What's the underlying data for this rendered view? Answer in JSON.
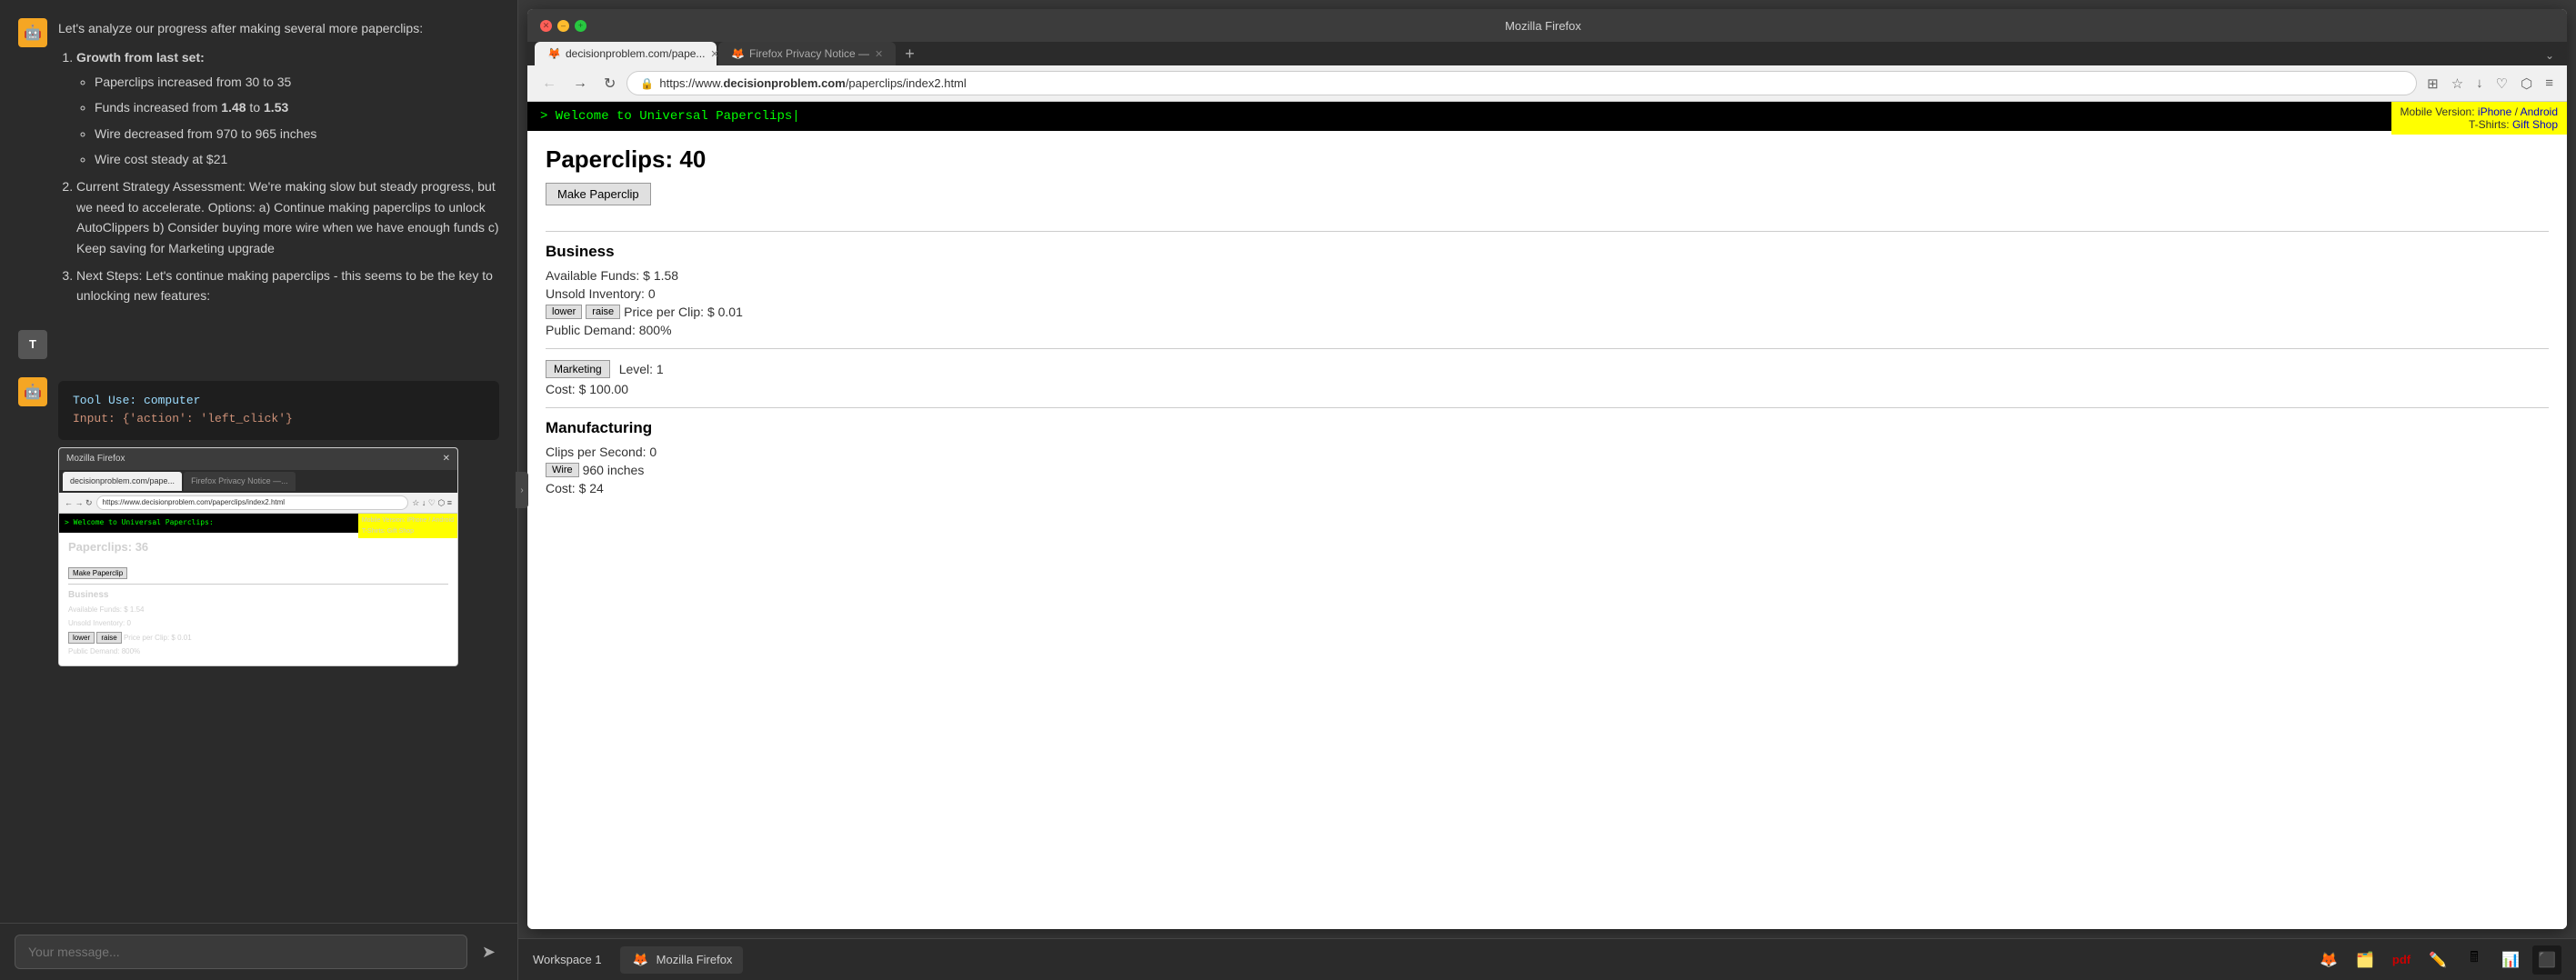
{
  "app": {
    "title": "Mozilla Firefox"
  },
  "left_panel": {
    "messages": [
      {
        "role": "ai",
        "avatar_emoji": "🤖",
        "content_html": "Let's analyze our progress after making several more paperclips:",
        "list_items": [
          {
            "label": "Growth from last set:",
            "sub_items": [
              "Paperclips increased from 30 to 35",
              "Funds increased from 1.48 to 1.53",
              "Wire decreased from 970 to 965 inches",
              "Wire cost steady at $21"
            ]
          },
          {
            "label": "Current Strategy Assessment: We're making slow but steady progress, but we need to accelerate. Options: a) Continue making paperclips to unlock AutoClippers b) Consider buying more wire when we have enough funds c) Keep saving for Marketing upgrade"
          },
          {
            "label": "Next Steps: Let's continue making paperclips - this seems to be the key to unlocking new features:"
          }
        ]
      },
      {
        "role": "user",
        "avatar_label": "T"
      },
      {
        "role": "ai_tool",
        "avatar_emoji": "🤖",
        "tool_text": "Tool Use:  computer",
        "input_text": "Input: {'action': 'left_click'}",
        "has_screenshot": true
      }
    ],
    "input_placeholder": "Your message...",
    "send_button_label": "➤"
  },
  "thumbnail": {
    "title": "Mozilla Firefox",
    "close_btn": "✕",
    "tabs": [
      {
        "label": "decisionproblem.com/pape...",
        "active": true
      },
      {
        "label": "Firefox Privacy Notice —...",
        "active": false
      }
    ],
    "url": "https://www.decisionproblem.com/paperclips/index2.html",
    "terminal_text": "> Welcome to Universal Paperclips:",
    "paperclips": "Paperclips: 36",
    "make_btn": "Make Paperclip",
    "business_title": "Business",
    "funds": "Available Funds: $ 1.54",
    "inventory": "Unsold Inventory: 0",
    "price_label": "Price per Clip: $ 0.01",
    "demand": "Public Demand: 800%"
  },
  "browser": {
    "title_bar": "Mozilla Firefox",
    "close_btn": "✕",
    "tabs": [
      {
        "label": "decisionproblem.com/pape...",
        "active": true,
        "favicon": "🦊"
      },
      {
        "label": "Firefox Privacy Notice —",
        "active": false,
        "favicon": "🦊"
      }
    ],
    "new_tab": "+",
    "url": "https://www.decisionproblem.com/paperclips/index2.html",
    "url_domain": "decisionproblem.com",
    "url_path": "/paperclips/index2.html",
    "mobile_banner": {
      "line1": "Mobile Version: iPhone / Android",
      "line2": "T-Shirts: Gift Shop"
    },
    "terminal": "> Welcome to Universal Paperclips|",
    "game": {
      "paperclips_label": "Paperclips: 40",
      "make_btn": "Make Paperclip",
      "business": {
        "title": "Business",
        "funds": "Available Funds: $ 1.58",
        "inventory": "Unsold Inventory: 0",
        "lower_btn": "lower",
        "raise_btn": "raise",
        "price": "Price per Clip: $ 0.01",
        "demand": "Public Demand: 800%"
      },
      "marketing": {
        "upgrade_btn": "Marketing",
        "level": "Level: 1",
        "cost": "Cost: $ 100.00"
      },
      "manufacturing": {
        "title": "Manufacturing",
        "clips_per_sec": "Clips per Second: 0",
        "wire_btn": "Wire",
        "wire_amount": "960 inches",
        "wire_cost": "Cost: $ 24"
      }
    }
  },
  "taskbar": {
    "workspace": "Workspace 1",
    "firefox_label": "Mozilla Firefox",
    "icons": [
      "🦊",
      "🗂️",
      "📄",
      "✏️",
      "🖩",
      "📊",
      "⬛"
    ]
  }
}
